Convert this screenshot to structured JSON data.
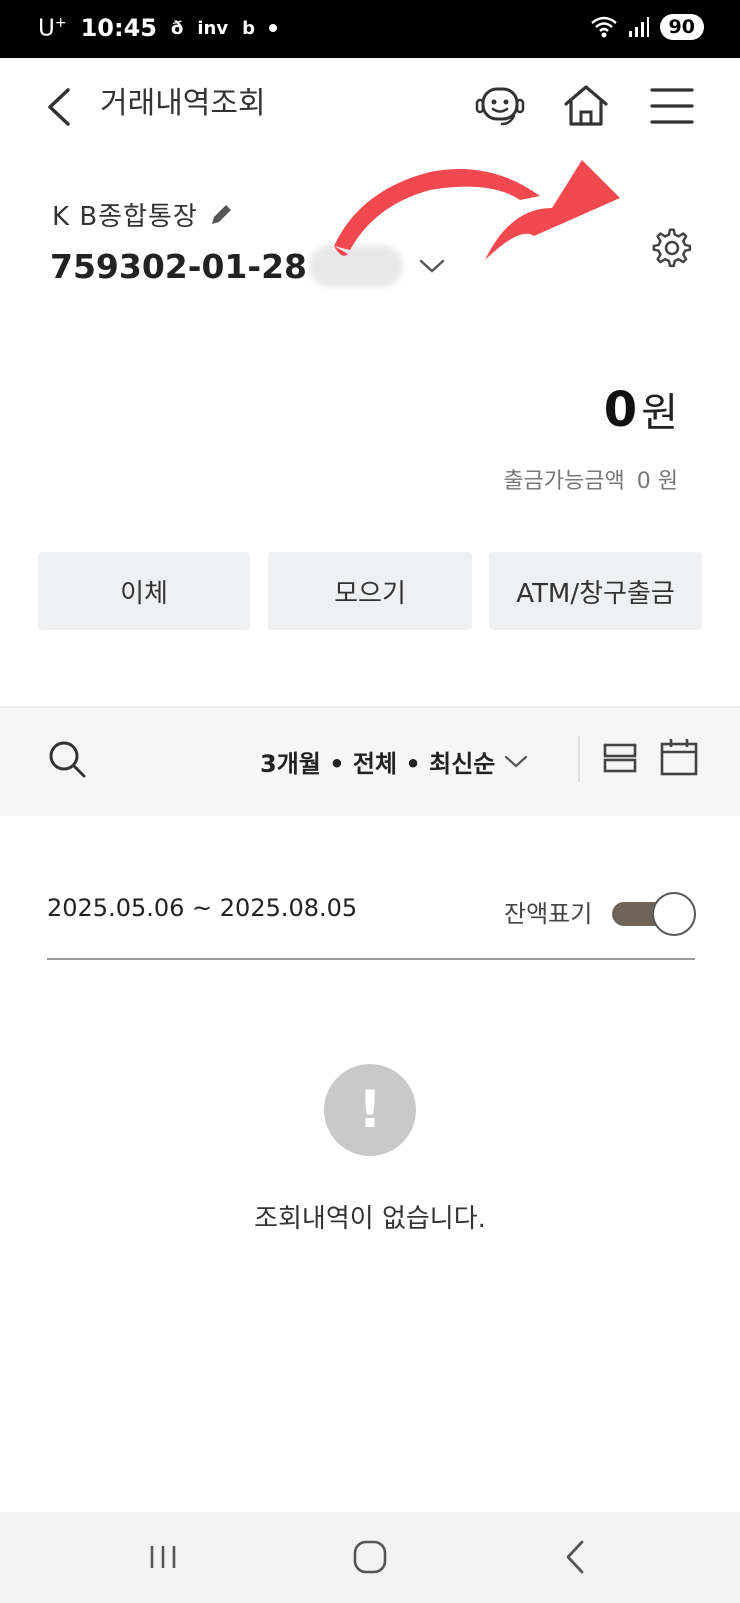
{
  "status_bar": {
    "carrier": "U",
    "carrier_sup": "+",
    "time": "10:45",
    "indicators": [
      "ð",
      "inv",
      "b"
    ],
    "battery": "90"
  },
  "header": {
    "title": "거래내역조회",
    "icons": [
      "back-icon",
      "chatbot-icon",
      "home-icon",
      "menu-icon"
    ]
  },
  "account": {
    "name": "K B종합통장",
    "number_visible": "759302-01-28",
    "number_masked": true
  },
  "balance": {
    "amount": "0",
    "unit": "원",
    "available_label": "출금가능금액",
    "available_value": "0 원"
  },
  "actions": [
    {
      "label": "이체"
    },
    {
      "label": "모으기"
    },
    {
      "label": "ATM/창구출금"
    }
  ],
  "filter": {
    "label": "3개월 • 전체 • 최신순"
  },
  "period": {
    "range": "2025.05.06 ~ 2025.08.05",
    "balance_toggle_label": "잔액표기",
    "balance_toggle_on": true
  },
  "empty_state": {
    "icon_glyph": "!",
    "message": "조회내역이 없습니다."
  },
  "colors": {
    "annotation_arrow": "#f2484f",
    "toggle_track": "#6e6457",
    "button_bg": "#eef0f2"
  }
}
